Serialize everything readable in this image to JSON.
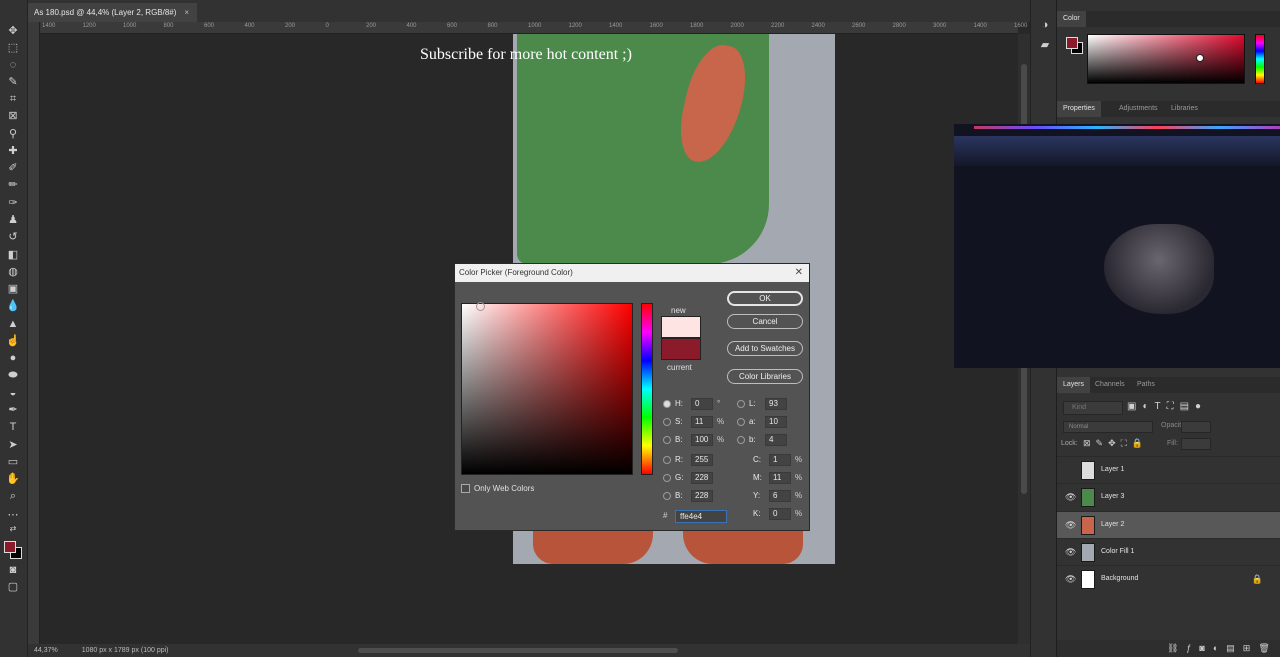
{
  "document_tab": {
    "title": "As 180.psd @ 44,4% (Layer 2, RGB/8#)",
    "close": "×"
  },
  "ruler_ticks": [
    "1400",
    "1200",
    "1000",
    "800",
    "600",
    "400",
    "200",
    "0",
    "200",
    "400",
    "600",
    "800",
    "1000",
    "1200",
    "1400",
    "1600",
    "1800",
    "2000",
    "2200",
    "2400",
    "2600",
    "2800",
    "3000",
    "1400",
    "1600"
  ],
  "watermark": "Subscribe for more hot content ;)",
  "status": {
    "zoom": "44,37%",
    "doc_size": "1080 px x 1789 px (100 ppi)"
  },
  "tools": [
    "move-icon",
    "marquee-icon",
    "lasso-icon",
    "quick-select-icon",
    "crop-icon",
    "frame-icon",
    "eyedropper-icon",
    "healing-icon",
    "brush-icon",
    "clone-stamp-icon",
    "history-brush-icon",
    "eraser-icon",
    "paint-bucket-icon",
    "gradient-icon",
    "blur-icon",
    "dodge-icon",
    "pen-icon",
    "type-icon",
    "path-select-icon",
    "shape-icon",
    "hand-icon",
    "zoom-icon",
    "more-icon"
  ],
  "color_panel": {
    "title": "Color"
  },
  "properties_tabs": [
    "Properties",
    "Adjustments",
    "Libraries"
  ],
  "layers_panel": {
    "tabs": [
      "Layers",
      "Channels",
      "Paths"
    ],
    "kind_placeholder": "Kind",
    "blend_mode": "Normal",
    "opacity_label": "Opacity:",
    "lock_label": "Lock:",
    "fill_label": "Fill:",
    "layers": [
      {
        "name": "Layer 1",
        "visible": false,
        "thumb": "#dcdcdc",
        "selected": false,
        "locked": false
      },
      {
        "name": "Layer 3",
        "visible": true,
        "thumb": "#4b8a4b",
        "selected": false,
        "locked": false
      },
      {
        "name": "Layer 2",
        "visible": true,
        "thumb": "#c7664a",
        "selected": true,
        "locked": false
      },
      {
        "name": "Color Fill 1",
        "visible": true,
        "thumb": "#a4a8b1",
        "selected": false,
        "locked": false
      },
      {
        "name": "Background",
        "visible": true,
        "thumb": "#ffffff",
        "selected": false,
        "locked": true
      }
    ]
  },
  "color_picker": {
    "title": "Color Picker (Foreground Color)",
    "new_label": "new",
    "current_label": "current",
    "new_color": "#ffe4e4",
    "current_color": "#8b1a2a",
    "ok": "OK",
    "cancel": "Cancel",
    "add_swatches": "Add to Swatches",
    "color_libraries": "Color Libraries",
    "only_web": "Only Web Colors",
    "hsb": [
      {
        "label": "H:",
        "value": "0",
        "unit": "°"
      },
      {
        "label": "S:",
        "value": "11",
        "unit": "%"
      },
      {
        "label": "B:",
        "value": "100",
        "unit": "%"
      }
    ],
    "rgb": [
      {
        "label": "R:",
        "value": "255"
      },
      {
        "label": "G:",
        "value": "228"
      },
      {
        "label": "B:",
        "value": "228"
      }
    ],
    "lab": [
      {
        "label": "L:",
        "value": "93"
      },
      {
        "label": "a:",
        "value": "10"
      },
      {
        "label": "b:",
        "value": "4"
      }
    ],
    "cmyk": [
      {
        "label": "C:",
        "value": "1",
        "unit": "%"
      },
      {
        "label": "M:",
        "value": "11",
        "unit": "%"
      },
      {
        "label": "Y:",
        "value": "6",
        "unit": "%"
      },
      {
        "label": "K:",
        "value": "0",
        "unit": "%"
      }
    ],
    "hex_label": "#",
    "hex": "ffe4e4"
  }
}
